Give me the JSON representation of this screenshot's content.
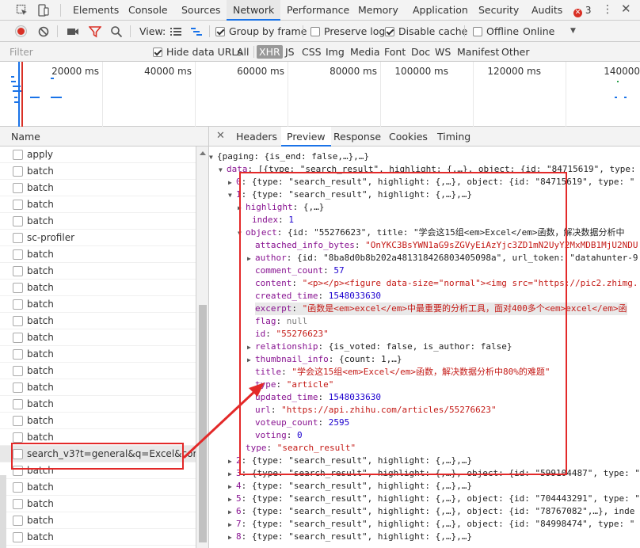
{
  "tabbar": {
    "tabs": [
      {
        "label": "Elements",
        "active": false
      },
      {
        "label": "Console",
        "active": false
      },
      {
        "label": "Sources",
        "active": false
      },
      {
        "label": "Network",
        "active": true
      },
      {
        "label": "Performance",
        "active": false
      },
      {
        "label": "Memory",
        "active": false
      },
      {
        "label": "Application",
        "active": false
      },
      {
        "label": "Security",
        "active": false
      },
      {
        "label": "Audits",
        "active": false
      }
    ],
    "error_count": "3"
  },
  "toolbar": {
    "view_label": "View:",
    "group_by_frame": {
      "label": "Group by frame",
      "checked": true
    },
    "preserve_log": {
      "label": "Preserve log",
      "checked": false
    },
    "disable_cache": {
      "label": "Disable cache",
      "checked": true
    },
    "offline": {
      "label": "Offline",
      "checked": false
    },
    "throttle": "Online"
  },
  "filterbar": {
    "placeholder": "Filter",
    "hide_data_urls": {
      "label": "Hide data URLs",
      "checked": true
    },
    "types": [
      {
        "label": "All",
        "active": false
      },
      {
        "label": "XHR",
        "active": true
      },
      {
        "label": "JS",
        "active": false
      },
      {
        "label": "CSS",
        "active": false
      },
      {
        "label": "Img",
        "active": false
      },
      {
        "label": "Media",
        "active": false
      },
      {
        "label": "Font",
        "active": false
      },
      {
        "label": "Doc",
        "active": false
      },
      {
        "label": "WS",
        "active": false
      },
      {
        "label": "Manifest",
        "active": false
      },
      {
        "label": "Other",
        "active": false
      }
    ]
  },
  "overview": {
    "labels": [
      "20000 ms",
      "40000 ms",
      "60000 ms",
      "80000 ms",
      "100000 ms",
      "120000 ms",
      "140000"
    ]
  },
  "request_list": {
    "header": "Name",
    "rows": [
      {
        "name": "apply",
        "selected": false
      },
      {
        "name": "batch",
        "selected": false
      },
      {
        "name": "batch",
        "selected": false
      },
      {
        "name": "batch",
        "selected": false
      },
      {
        "name": "batch",
        "selected": false
      },
      {
        "name": "sc-profiler",
        "selected": false
      },
      {
        "name": "batch",
        "selected": false
      },
      {
        "name": "batch",
        "selected": false
      },
      {
        "name": "batch",
        "selected": false
      },
      {
        "name": "batch",
        "selected": false
      },
      {
        "name": "batch",
        "selected": false
      },
      {
        "name": "batch",
        "selected": false
      },
      {
        "name": "batch",
        "selected": false
      },
      {
        "name": "batch",
        "selected": false
      },
      {
        "name": "batch",
        "selected": false
      },
      {
        "name": "batch",
        "selected": false
      },
      {
        "name": "batch",
        "selected": false
      },
      {
        "name": "batch",
        "selected": false
      },
      {
        "name": "search_v3?t=general&q=Excel&correctio",
        "selected": true
      },
      {
        "name": "batch",
        "selected": false
      },
      {
        "name": "batch",
        "selected": false
      },
      {
        "name": "batch",
        "selected": false
      },
      {
        "name": "batch",
        "selected": false
      },
      {
        "name": "batch",
        "selected": false
      },
      {
        "name": "batch",
        "selected": false
      }
    ]
  },
  "detail": {
    "tabs": [
      {
        "label": "Headers",
        "active": false
      },
      {
        "label": "Preview",
        "active": true
      },
      {
        "label": "Response",
        "active": false
      },
      {
        "label": "Cookies",
        "active": false
      },
      {
        "label": "Timing",
        "active": false
      }
    ],
    "preview_lines": [
      "{paging: {is_end: false,…},…}",
      "data: [{type: \"search_result\", highlight: {,…}, object: {id: \"84715619\", type: \"",
      "0: {type: \"search_result\", highlight: {,…}, object: {id: \"84715619\", type: \"",
      "1: {type: \"search_result\", highlight: {,…},…}",
      "highlight: {,…}",
      "index: 1",
      "object: {id: \"55276623\", title: \"学会这15组<em>Excel</em>函数，解决数据分析中",
      "attached_info_bytes: \"OnYKC3BsYWN1aG9sZGVyEiAzYjc3ZD1mN2UyY2MxMDB1MjU2NDU",
      "author: {id: \"8ba8d0b8b202a481318426803405098a\", url_token: \"datahunter-9",
      "comment_count: 57",
      "content: \"<p></p><figure data-size=\"normal\"><img src=\"https://pic2.zhimg.",
      "created_time: 1548033630",
      "excerpt: \"函数是<em>excel</em>中最重要的分析工具，面对400多个<em>excel</em>函",
      "flag: null",
      "id: \"55276623\"",
      "relationship: {is_voted: false, is_author: false}",
      "thumbnail_info: {count: 1,…}",
      "title: \"学会这15组<em>Excel</em>函数，解决数据分析中80%的难题\"",
      "type: \"article\"",
      "updated_time: 1548033630",
      "url: \"https://api.zhihu.com/articles/55276623\"",
      "voteup_count: 2595",
      "voting: 0",
      "type: \"search_result\"",
      "2: {type: \"search_result\", highlight: {,…},…}",
      "3: {type: \"search_result\", highlight: {,…}, object: {id: \"599104487\", type: \"",
      "4: {type: \"search_result\", highlight: {,…},…}",
      "5: {type: \"search_result\", highlight: {,…}, object: {id: \"704443291\", type: \"",
      "6: {type: \"search_result\", highlight: {,…}, object: {id: \"78767082\",…}, inde",
      "7: {type: \"search_result\", highlight: {,…}, object: {id: \"84998474\", type: \"",
      "8: {type: \"search_result\", highlight: {,…},…}"
    ]
  },
  "colors": {
    "accent": "#1a73e8",
    "annotation_red": "#e32929",
    "json_key": "#881391",
    "json_string": "#c41a16",
    "json_number": "#1c00cf"
  }
}
